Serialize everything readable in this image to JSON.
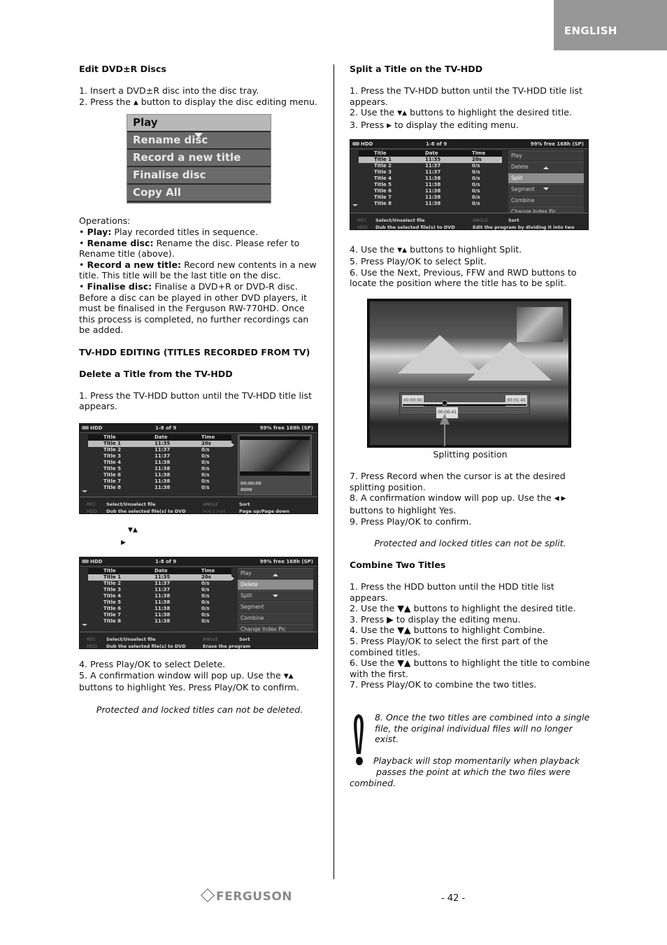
{
  "header": {
    "language_tab": "ENGLISH"
  },
  "left": {
    "edit_dvd": {
      "heading": "Edit DVD±R Discs",
      "step1": "1. Insert a DVD±R disc into the disc tray.",
      "step2_pre": "2. Press the ",
      "step2_post": " button to display the disc editing menu.",
      "up_glyph": "▲"
    },
    "disc_menu": {
      "items": [
        "Play",
        "Rename disc",
        "Record a new title",
        "Finalise disc",
        "Copy All"
      ],
      "selected": "Play"
    },
    "operations": {
      "label": "Operations:",
      "bullet": "•",
      "items": [
        {
          "term": "Play:",
          "desc": " Play recorded titles in sequence."
        },
        {
          "term": "Rename disc:",
          "desc": " Rename the disc. Please refer to Rename title (above)."
        },
        {
          "term": "Record a new title:",
          "desc": " Record new contents in a new title. This title will be the last title on the disc."
        },
        {
          "term": "Finalise disc:",
          "desc": " Finalise a DVD+R or DVD-R disc. Before a disc can be played in other DVD players, it must be finalised in the Ferguson RW-770HD. Once this process is completed, no further recordings can be added."
        }
      ]
    },
    "tvhdd_heading": "TV-HDD EDITING (TITLES RECORDED FROM TV)",
    "delete": {
      "heading": "Delete a Title from the TV-HDD",
      "step1": "1. Press the TV-HDD button until the TV-HDD title list appears.",
      "step2_glyphs": "▼▲",
      "step3_glyph": "▶",
      "step4": "4. Press Play/OK to select Delete.",
      "step5_pre": "5. A confirmation window will pop up. Use the ",
      "step5_glyphs": "▼▲",
      "step5_post": " buttons to highlight Yes. Press Play/OK to confirm.",
      "note": "Protected and locked titles can not be deleted."
    }
  },
  "hdd_screen_common": {
    "device": "HDD",
    "range": "1-8   of  9",
    "free": "99% free 168h (SP)",
    "columns": [
      "Title",
      "Date",
      "Time"
    ],
    "rows": [
      [
        "Title 1",
        "11:35",
        "20s"
      ],
      [
        "Title 2",
        "11:37",
        "0/s"
      ],
      [
        "Title 3",
        "11:37",
        "0/s"
      ],
      [
        "Title 4",
        "11:38",
        "0/s"
      ],
      [
        "Title 5",
        "11:38",
        "0/s"
      ],
      [
        "Title 6",
        "11:38",
        "0/s"
      ],
      [
        "Title 7",
        "11:38",
        "0/s"
      ],
      [
        "Title 8",
        "11:38",
        "0/s"
      ]
    ],
    "footer": {
      "rec_key": "REC",
      "rec_label": "Select/Unselect file",
      "hdd_key": "HDD",
      "hdd_label": "Dub the selected file(s) to DVD",
      "angle_key": "ANGLE",
      "angle_label": "Sort"
    }
  },
  "hdd_screen_1": {
    "extra_key": "I<< / >>I",
    "extra_label": "Page up/Page down",
    "preview_meta": [
      "00:00:00",
      "0000"
    ]
  },
  "hdd_screen_2": {
    "menu_items": [
      "Play",
      "Delete",
      "Split",
      "Segment",
      "Combine",
      "Change Index Pic"
    ],
    "selected": "Delete",
    "extra_label": "Erase the program"
  },
  "right": {
    "split": {
      "heading": "Split a Title on the TV-HDD",
      "step1": "1. Press the TV-HDD button until the TV-HDD title list appears.",
      "step2_pre": "2. Use the ",
      "step2_post": " buttons to highlight the desired title.",
      "step3_pre": "3. Press ",
      "step3_post": " to display the editing menu.",
      "step4_pre": "4. Use the ",
      "step4_post": " buttons to highlight Split.",
      "step5": "5. Press Play/OK to select Split.",
      "step6": "6. Use the Next, Previous, FFW and RWD buttons to locate the position where the title has to be split.",
      "step7": "7. Press Record when the cursor is at the desired splitting position.",
      "step8_pre": "8. A confirmation window will pop up. Use the ",
      "step8_glyphs": "◀ ▶",
      "step8_post": " buttons to highlight Yes.",
      "step9": "9. Press Play/OK to confirm.",
      "note": "Protected and locked titles can not be split.",
      "caption": "Splitting position",
      "updown": "▼▲",
      "right": "▶"
    },
    "split_screen": {
      "menu_items": [
        "Play",
        "Delete",
        "Split",
        "Segment",
        "Combine",
        "Change Index Pic"
      ],
      "selected": "Split",
      "extra_label": "Edit the program by dividing it into two"
    },
    "split_video": {
      "start_time": "00:00:00",
      "end_time": "00:01:45",
      "cursor_time": "00:00:41",
      "cursor_fraction": 0.34
    },
    "combine": {
      "heading": "Combine Two Titles",
      "steps": [
        "1. Press the HDD button until the HDD title list appears.",
        "2. Use the ▼▲ buttons to highlight the desired title.",
        "3. Press ▶ to display the editing menu.",
        "4. Use the ▼▲ buttons to highlight Combine.",
        "5. Press Play/OK to select the first part of the combined titles.",
        "6. Use the ▼▲ buttons to highlight the title to combine with the first.",
        "7. Press Play/OK to combine the two titles."
      ]
    },
    "warning": {
      "para1": "8. Once the two titles are combined into a single file, the original individual files will no longer exist.",
      "para2_line1": "Playback will stop momentarily when playback",
      "para2_line2": "passes the point at which the two files were",
      "para2_line3": "combined."
    }
  },
  "footer": {
    "brand": "FERGUSON",
    "page": "- 42 -"
  }
}
